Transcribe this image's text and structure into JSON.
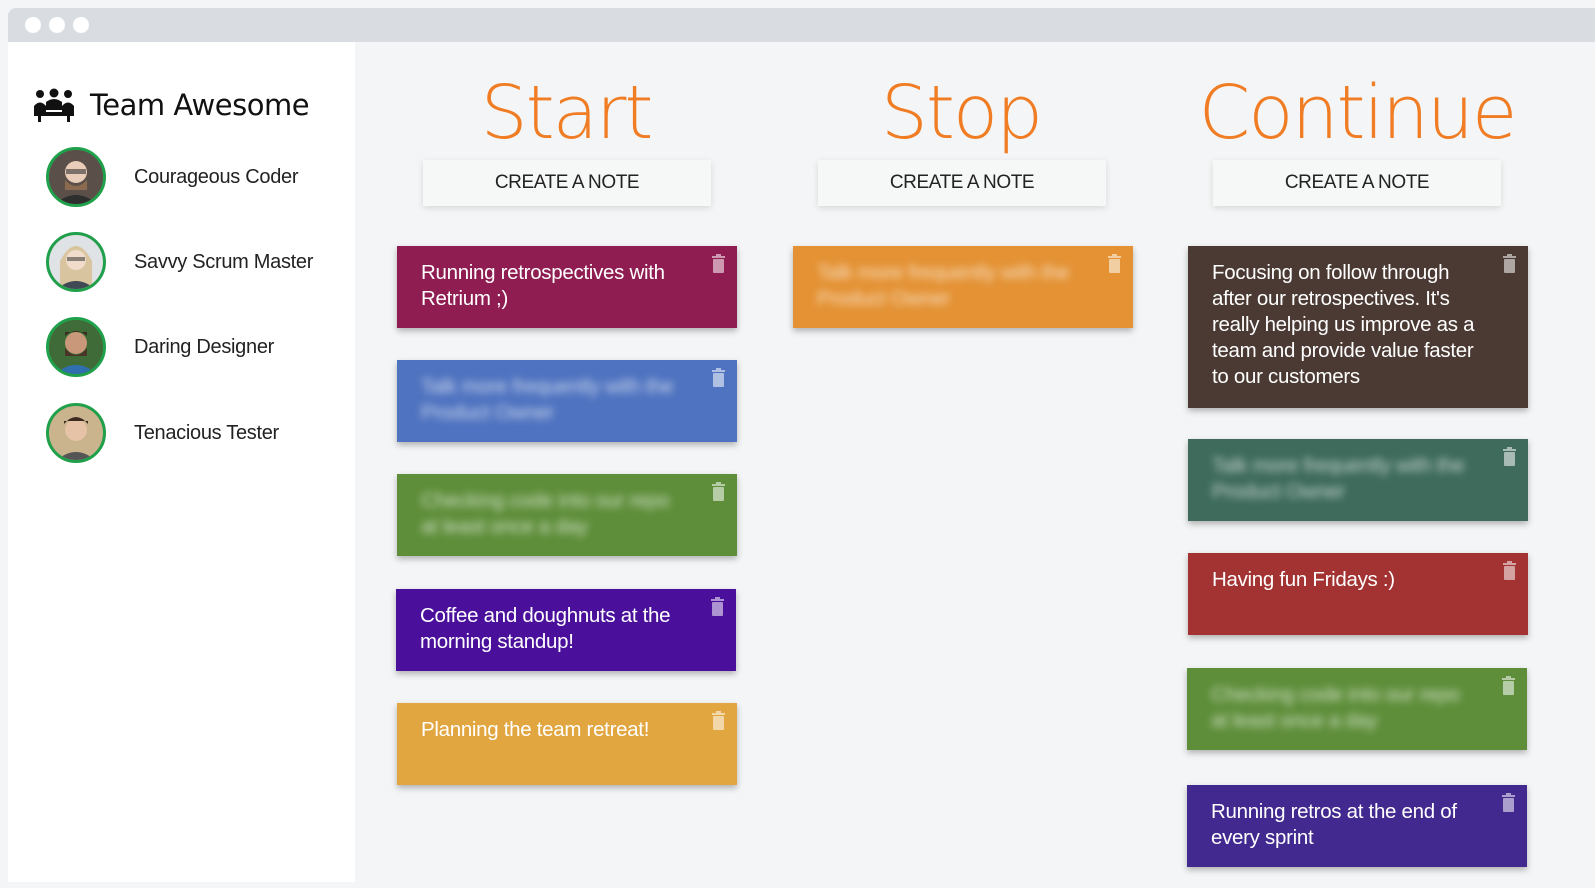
{
  "team": {
    "name": "Team Awesome",
    "icon": "team-icon"
  },
  "members": [
    {
      "name": "Courageous Coder"
    },
    {
      "name": "Savvy Scrum Master"
    },
    {
      "name": "Daring Designer"
    },
    {
      "name": "Tenacious Tester"
    }
  ],
  "columns": [
    {
      "title": "Start",
      "create_label": "CREATE A NOTE",
      "notes": [
        {
          "text": "Running retrospectives with Retrium ;)",
          "color": "#8f1d52",
          "blurred": false
        },
        {
          "text": "Talk more frequently with the Product Owner",
          "color": "#4f73c0",
          "blurred": true
        },
        {
          "text": "Checking code into our repo at least once a day",
          "color": "#5e8e3a",
          "blurred": true
        },
        {
          "text": "Coffee and doughnuts at the morning standup!",
          "color": "#4a109c",
          "blurred": false
        },
        {
          "text": "Planning the team retreat!",
          "color": "#e2a640",
          "blurred": false
        }
      ]
    },
    {
      "title": "Stop",
      "create_label": "CREATE A NOTE",
      "notes": [
        {
          "text": "Talk more frequently with the Product Owner",
          "color": "#e49234",
          "blurred": true
        }
      ]
    },
    {
      "title": "Continue",
      "create_label": "CREATE A NOTE",
      "notes": [
        {
          "text": "Focusing on follow through after our retrospectives. It's really helping us improve as a team and provide value faster to our customers",
          "color": "#4a3a33",
          "blurred": false
        },
        {
          "text": "Talk more frequently with the Product Owner",
          "color": "#3e6b5c",
          "blurred": true
        },
        {
          "text": "Having fun Fridays :)",
          "color": "#a33232",
          "blurred": false
        },
        {
          "text": "Checking code into our repo at least once a day",
          "color": "#5e8e3a",
          "blurred": true
        },
        {
          "text": "Running retros at the end of every sprint",
          "color": "#42298f",
          "blurred": false
        }
      ]
    }
  ]
}
